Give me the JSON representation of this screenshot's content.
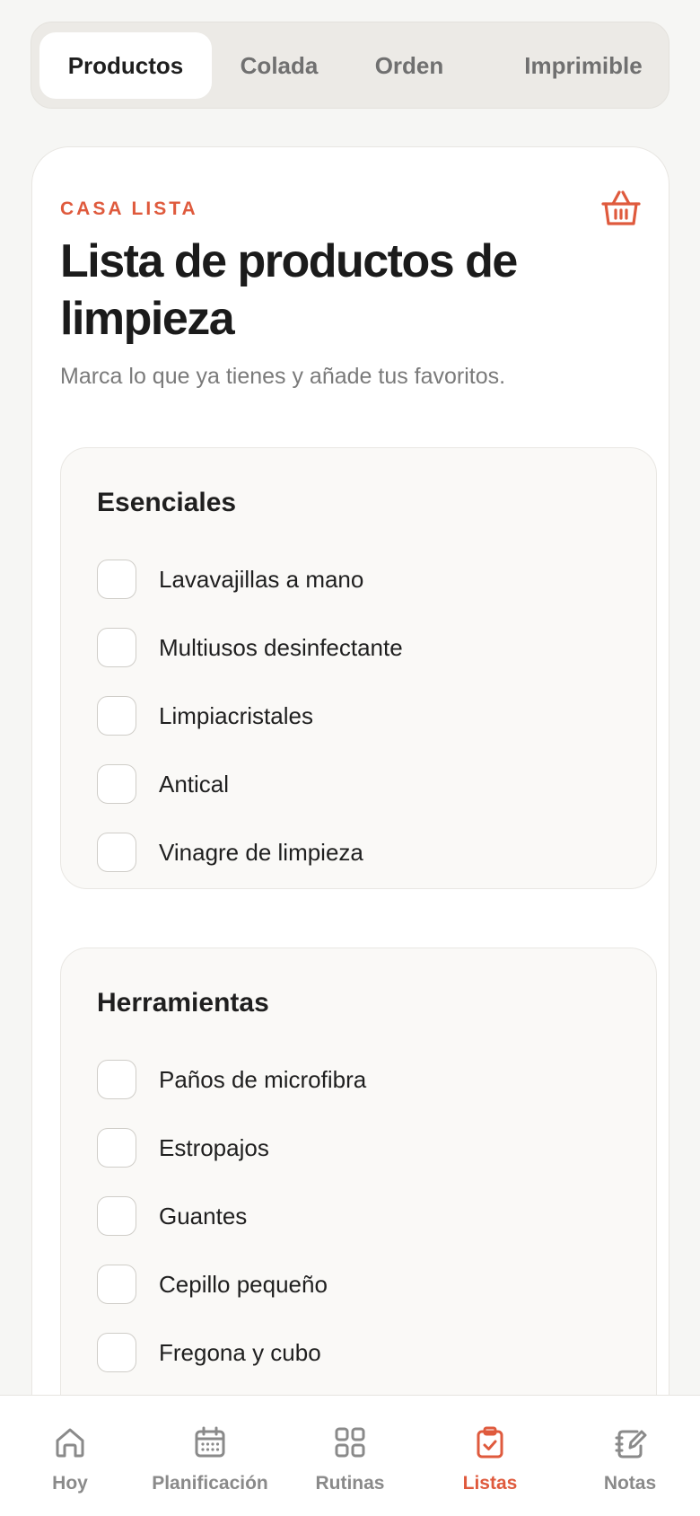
{
  "tabs": [
    {
      "label": "Productos",
      "active": true
    },
    {
      "label": "Colada",
      "active": false
    },
    {
      "label": "Orden",
      "active": false
    },
    {
      "label": "Imprimible",
      "active": false
    }
  ],
  "card": {
    "eyebrow": "CASA LISTA",
    "icon": "basket-icon",
    "title": "Lista de productos de limpieza",
    "subtitle": "Marca lo que ya tienes y añade tus favoritos."
  },
  "sections": [
    {
      "title": "Esenciales",
      "items": [
        {
          "label": "Lavavajillas a mano",
          "checked": false
        },
        {
          "label": "Multiusos desinfectante",
          "checked": false
        },
        {
          "label": "Limpiacristales",
          "checked": false
        },
        {
          "label": "Antical",
          "checked": false
        },
        {
          "label": "Vinagre de limpieza",
          "checked": false
        }
      ]
    },
    {
      "title": "Herramientas",
      "items": [
        {
          "label": "Paños de microfibra",
          "checked": false
        },
        {
          "label": "Estropajos",
          "checked": false
        },
        {
          "label": "Guantes",
          "checked": false
        },
        {
          "label": "Cepillo pequeño",
          "checked": false
        },
        {
          "label": "Fregona y cubo",
          "checked": false
        }
      ]
    }
  ],
  "bottom_nav": [
    {
      "label": "Hoy",
      "icon": "home-icon",
      "active": false
    },
    {
      "label": "Planificación",
      "icon": "calendar-icon",
      "active": false
    },
    {
      "label": "Rutinas",
      "icon": "grid-icon",
      "active": false
    },
    {
      "label": "Listas",
      "icon": "clipboard-check-icon",
      "active": true
    },
    {
      "label": "Notas",
      "icon": "notebook-edit-icon",
      "active": false
    }
  ],
  "colors": {
    "accent": "#df5a3d",
    "background": "#f6f6f4",
    "card": "#ffffff",
    "section": "#faf9f7"
  }
}
